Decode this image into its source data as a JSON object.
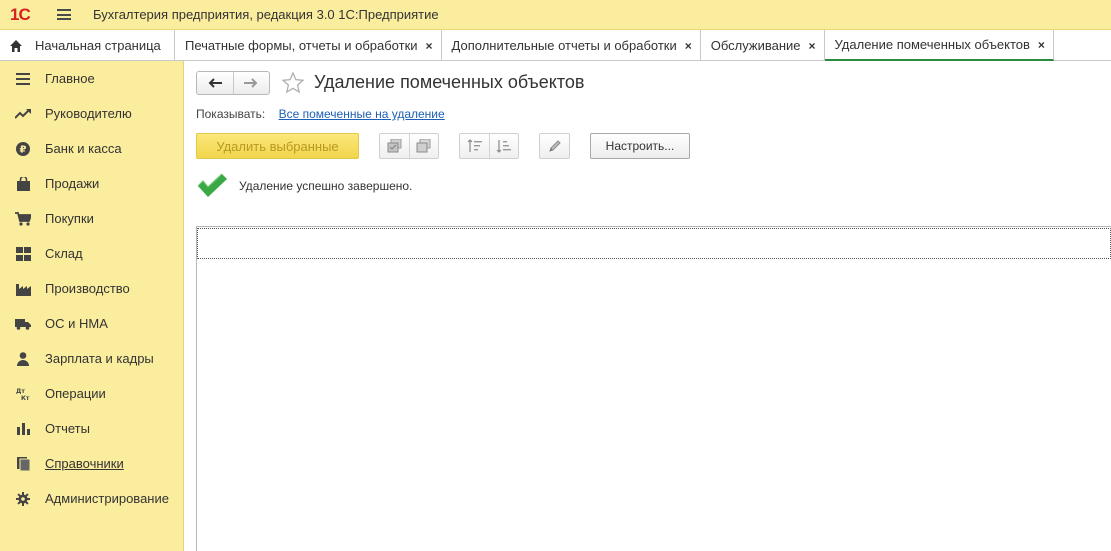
{
  "app": {
    "logo": "1С",
    "title": "Бухгалтерия предприятия, редакция 3.0 1С:Предприятие"
  },
  "tabs": [
    {
      "label": "Начальная страница",
      "closable": false
    },
    {
      "label": "Печатные формы, отчеты и обработки",
      "closable": true
    },
    {
      "label": "Дополнительные отчеты и обработки",
      "closable": true
    },
    {
      "label": "Обслуживание",
      "closable": true
    },
    {
      "label": "Удаление помеченных объектов",
      "closable": true,
      "active": true
    }
  ],
  "tab_close_glyph": "×",
  "sidebar": {
    "items": [
      {
        "label": "Главное",
        "icon": "menu-lines-icon"
      },
      {
        "label": "Руководителю",
        "icon": "trend-icon"
      },
      {
        "label": "Банк и касса",
        "icon": "ruble-coin-icon"
      },
      {
        "label": "Продажи",
        "icon": "shopping-bag-icon"
      },
      {
        "label": "Покупки",
        "icon": "cart-icon"
      },
      {
        "label": "Склад",
        "icon": "warehouse-grid-icon"
      },
      {
        "label": "Производство",
        "icon": "factory-icon"
      },
      {
        "label": "ОС и НМА",
        "icon": "truck-icon"
      },
      {
        "label": "Зарплата и кадры",
        "icon": "person-icon"
      },
      {
        "label": "Операции",
        "icon": "dt-kt-icon"
      },
      {
        "label": "Отчеты",
        "icon": "bar-chart-icon"
      },
      {
        "label": "Справочники",
        "icon": "book-icon"
      },
      {
        "label": "Администрирование",
        "icon": "gear-icon"
      }
    ]
  },
  "page": {
    "title": "Удаление помеченных объектов",
    "show_label": "Показывать:",
    "show_value": "Все помеченные на удаление",
    "delete_button": "Удалить выбранные",
    "setup_button": "Настроить...",
    "status_message": "Удаление успешно завершено."
  },
  "colors": {
    "accent_yellow": "#fbed9e",
    "logo_red": "#d6211d",
    "link_blue": "#1c5fb5",
    "active_tab_green": "#2b8a3e",
    "success_green": "#3aa845"
  }
}
